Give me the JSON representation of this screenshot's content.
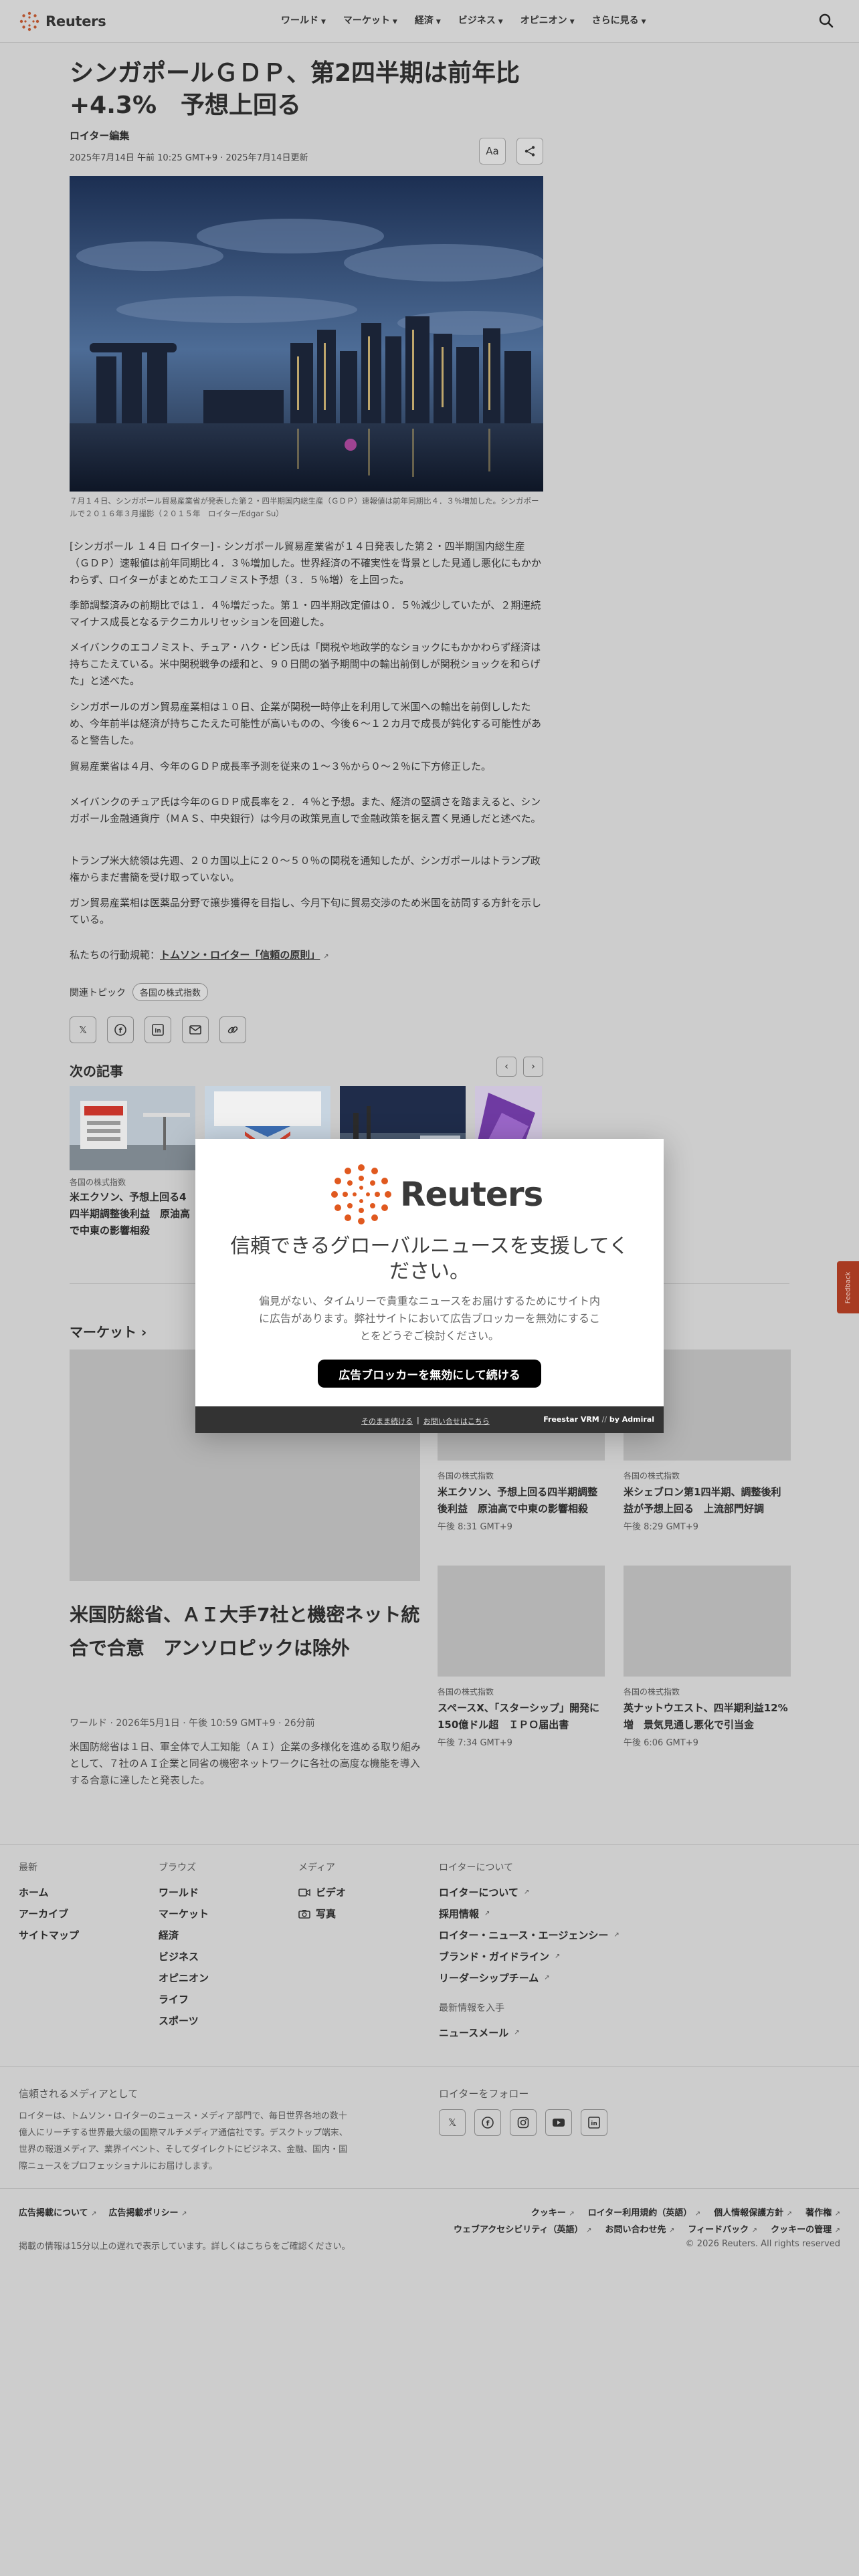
{
  "header": {
    "logo_text": "Reuters",
    "nav": [
      {
        "label": "ワールド"
      },
      {
        "label": "マーケット"
      },
      {
        "label": "経済"
      },
      {
        "label": "ビジネス"
      },
      {
        "label": "オピニオン"
      },
      {
        "label": "さらに見る"
      }
    ]
  },
  "article": {
    "title": "シンガポールＧＤＰ、第2四半期は前年比+4.3%　予想上回る",
    "byline": "ロイター編集",
    "dateline": "2025年7月14日 午前 10:25 GMT+9 · 2025年7月14日更新",
    "text_size_label": "Aa",
    "caption": "７月１４日、シンガポール貿易産業省が発表した第２・四半期国内総生産（ＧＤＰ）速報値は前年同期比４．３％増加した。シンガポールで２０１６年３月撮影（２０１５年　ロイター/Edgar Su）",
    "paragraphs": [
      "[シンガポール １４日 ロイター] - シンガポール貿易産業省が１４日発表した第２・四半期国内総生産（ＧＤＰ）速報値は前年同期比４．３％増加した。世界経済の不確実性を背景とした見通し悪化にもかかわらず、ロイターがまとめたエコノミスト予想（３．５％増）を上回った。",
      "季節調整済みの前期比では１．４％増だった。第１・四半期改定値は０．５％減少していたが、２期連続マイナス成長となるテクニカルリセッションを回避した。",
      "メイバンクのエコノミスト、チュア・ハク・ビン氏は「関税や地政学的なショックにもかかわらず経済は持ちこたえている。米中関税戦争の緩和と、９０日間の猶予期間中の輸出前倒しが関税ショックを和らげた」と述べた。",
      "シンガポールのガン貿易産業相は１０日、企業が関税一時停止を利用して米国への輸出を前倒ししたため、今年前半は経済が持ちこたえた可能性が高いものの、今後６～１２カ月で成長が鈍化する可能性があると警告した。",
      "貿易産業省は４月、今年のＧＤＰ成長率予測を従来の１～３％から０～２％に下方修正した。",
      "メイバンクのチュア氏は今年のＧＤＰ成長率を２．４％と予想。また、経済の堅調さを踏まえると、シンガポール金融通貨庁（ＭＡＳ、中央銀行）は今月の政策見直しで金融政策を据え置く見通しだと述べた。",
      "トランプ米大統領は先週、２０カ国以上に２０～５０％の関税を通知したが、シンガポールはトランプ政権からまだ書簡を受け取っていない。",
      "ガン貿易産業相は医薬品分野で譲歩獲得を目指し、今月下旬に貿易交渉のため米国を訪問する方針を示している。"
    ],
    "trust_prefix": "私たちの行動規範：",
    "trust_link": "トムソン・ロイター「信頼の原則」",
    "topics_label": "関連トピック",
    "topic_chip": "各国の株式指数"
  },
  "share_icons": [
    "x-icon",
    "facebook-icon",
    "linkedin-icon",
    "email-icon",
    "link-icon"
  ],
  "next": {
    "heading": "次の記事",
    "cards": [
      {
        "category": "各国の株式指数",
        "headline": "米エクソン、予想上回る4四半期調整後利益　原油高で中東の影響相殺"
      },
      {
        "category": "",
        "headline": ""
      },
      {
        "category": "",
        "headline": ""
      },
      {
        "category": "",
        "headline": ""
      }
    ]
  },
  "markets": {
    "heading": "マーケット",
    "big": {
      "title": "米国防総省、ＡＩ大手7社と機密ネット統合で合意　アンソロピックは除外",
      "meta": "ワールド · 2026年5月1日 · 午後 10:59 GMT+9 · 26分前",
      "desc": "米国防総省は１日、軍全体で人工知能（ＡＩ）企業の多様化を進める取り組みとして、７社のＡＩ企業と同省の機密ネットワークに各社の高度な機能を導入する合意に達したと発表した。"
    },
    "cards": [
      {
        "category": "各国の株式指数",
        "headline": "米エクソン、予想上回る四半期調整後利益　原油高で中東の影響相殺",
        "time": "午後 8:31 GMT+9"
      },
      {
        "category": "各国の株式指数",
        "headline": "米シェブロン第1四半期、調整後利益が予想上回る　上流部門好調",
        "time": "午後 8:29 GMT+9"
      },
      {
        "category": "各国の株式指数",
        "headline": "スペースX、「スターシップ」開発に150億ドル超　ＩＰＯ届出書",
        "time": "午後 7:34 GMT+9"
      },
      {
        "category": "各国の株式指数",
        "headline": "英ナットウエスト、四半期利益12%増　景気見通し悪化で引当金",
        "time": "午後 6:06 GMT+9"
      }
    ]
  },
  "footer": {
    "cols": [
      {
        "heading": "最新",
        "items": [
          "ホーム",
          "アーカイブ",
          "サイトマップ"
        ]
      },
      {
        "heading": "ブラウズ",
        "items": [
          "ワールド",
          "マーケット",
          "経済",
          "ビジネス",
          "オピニオン",
          "ライフ",
          "スポーツ"
        ]
      },
      {
        "heading": "メディア",
        "items": [
          "ビデオ",
          "写真"
        ]
      },
      {
        "heading": "ロイターについて",
        "items": [
          "ロイターについて",
          "採用情報",
          "ロイター・ニュース・エージェンシー",
          "ブランド・ガイドライン",
          "リーダーシップチーム"
        ]
      }
    ],
    "updates_heading": "最新情報を入手",
    "newsletter": "ニュースメール",
    "trusted_heading": "信頼されるメディアとして",
    "trusted_text": "ロイターは、トムソン・ロイターのニュース・メディア部門で、毎日世界各地の数十億人にリーチする世界最大級の国際マルチメディア通信社です。デスクトップ端末、世界の報道メディア、業界イベント、そしてダイレクトにビジネス、金融、国内・国際ニュースをプロフェッショナルにお届けします。",
    "follow_heading": "ロイターをフォロー",
    "legal_left": [
      "広告掲載について",
      "広告掲載ポリシー"
    ],
    "legal_right": [
      "クッキー",
      "ロイター利用規約（英語）",
      "個人情報保護方針",
      "著作権",
      "ウェブアクセシビリティ（英語）",
      "お問い合わせ先",
      "フィードバック",
      "クッキーの管理"
    ],
    "delay_note": "掲載の情報は15分以上の遅れで表示しています。詳しくはこちらをご確認ください。",
    "copyright": "© 2026 Reuters. All rights reserved"
  },
  "feedback_tab": "Feedback",
  "modal": {
    "logo_text": "Reuters",
    "heading": "信頼できるグローバルニュースを支援してください。",
    "subtext": "偏見がない、タイムリーで貴重なニュースをお届けするためにサイト内に広告があります。弊社サイトにおいて広告ブロッカーを無効にすることをどうぞご検討ください。",
    "button": "広告ブロッカーを無効にして続ける",
    "footer_link1": "そのまま続ける",
    "footer_sep": "|",
    "footer_link2": "お問い合せはこちら",
    "powered": "Freestar VRM",
    "powered_by": "by Admiral"
  }
}
